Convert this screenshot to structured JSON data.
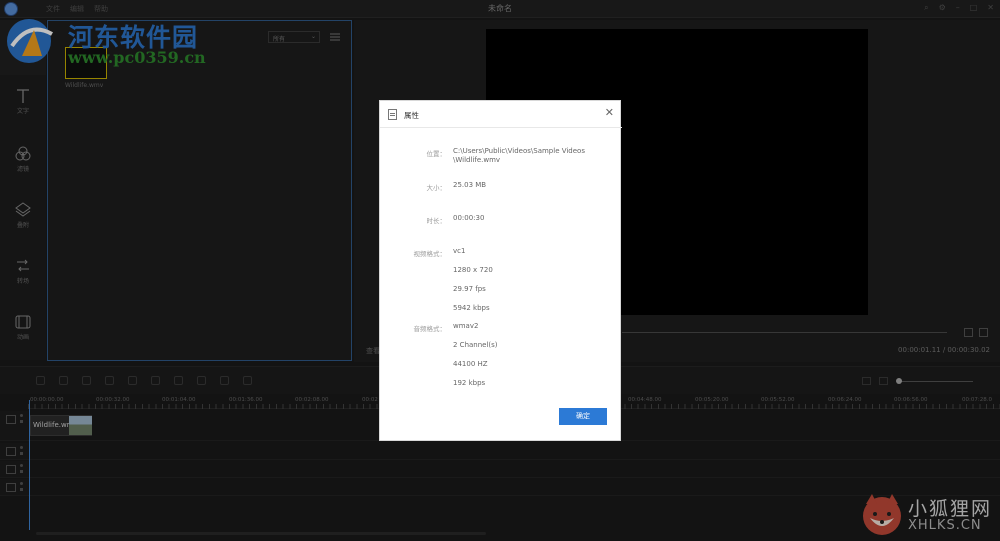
{
  "window": {
    "title": "未命名",
    "menu": [
      "文件",
      "编辑",
      "帮助"
    ]
  },
  "watermarks": {
    "left_title": "河东软件园",
    "left_url": "www.pc0359.cn",
    "right_title": "小狐狸网",
    "right_url": "XHLKS.CN"
  },
  "sidebar": {
    "items": [
      {
        "label": "文字",
        "icon": "text-icon"
      },
      {
        "label": "滤镜",
        "icon": "filter-icon"
      },
      {
        "label": "叠附",
        "icon": "overlay-icon"
      },
      {
        "label": "转场",
        "icon": "transition-icon"
      },
      {
        "label": "动画",
        "icon": "animation-icon"
      }
    ]
  },
  "media": {
    "filter": "所有",
    "file_name": "Wildlife.wmv"
  },
  "preview": {
    "label": "查看",
    "timecode": "00:00:01.11 / 00:00:30.02"
  },
  "timeline": {
    "clip_name": "Wildlife.wmv",
    "ruler_labels": [
      "00:00:00.00",
      "00:00:32.00",
      "00:01:04.00",
      "00:01:36.00",
      "00:02:08.00",
      "00:02",
      "00:04:48.00",
      "00:05:20.00",
      "00:05:52.00",
      "00:06:24.00",
      "00:06:56.00",
      "00:07:28.0"
    ]
  },
  "dialog": {
    "title": "属性",
    "location_label": "位置：",
    "location_line1": "C:\\Users\\Public\\Videos\\Sample Videos",
    "location_line2": "\\Wildlife.wmv",
    "size_label": "大小：",
    "size": "25.03 MB",
    "duration_label": "时长：",
    "duration": "00:00:30",
    "video_label": "视频格式：",
    "video_codec": "vc1",
    "resolution": "1280 x 720",
    "fps": "29.97 fps",
    "video_bitrate": "5942 kbps",
    "audio_label": "音频格式：",
    "audio_codec": "wmav2",
    "channels": "2 Channel(s)",
    "sample_rate": "44100 HZ",
    "audio_bitrate": "192 kbps",
    "ok_label": "确定"
  }
}
